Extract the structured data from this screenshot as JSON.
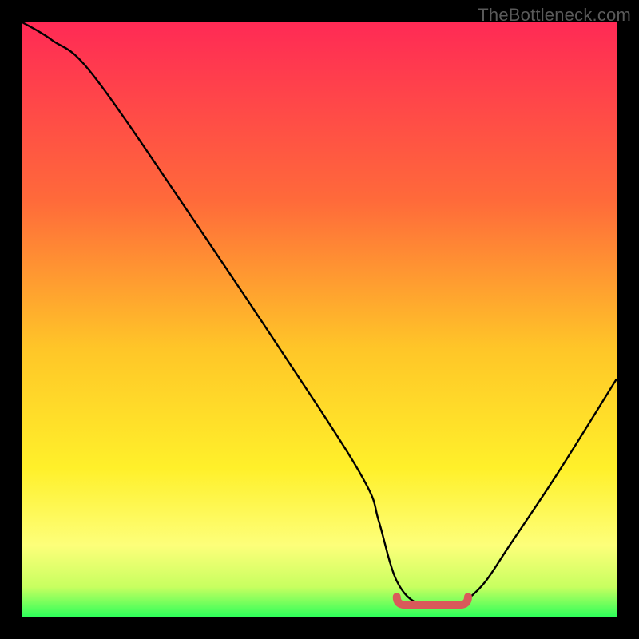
{
  "watermark": "TheBottleneck.com",
  "chart_data": {
    "type": "line",
    "title": "",
    "xlabel": "",
    "ylabel": "",
    "xlim": [
      0,
      100
    ],
    "ylim": [
      0,
      100
    ],
    "series": [
      {
        "name": "bottleneck-curve",
        "color": "#000000",
        "x": [
          0,
          5,
          12,
          30,
          50,
          58,
          60,
          63,
          67,
          73,
          75,
          78,
          82,
          90,
          100
        ],
        "y": [
          100,
          97,
          91,
          65,
          35,
          22,
          16,
          6,
          2,
          2,
          3,
          6,
          12,
          24,
          40
        ]
      },
      {
        "name": "optimal-range",
        "color": "#d95a5a",
        "x_start": 63,
        "x_end": 75,
        "y_level": 2
      }
    ],
    "gradient_stops": [
      {
        "offset": 0.0,
        "color": "#ff2a55"
      },
      {
        "offset": 0.3,
        "color": "#ff6a3a"
      },
      {
        "offset": 0.55,
        "color": "#ffc628"
      },
      {
        "offset": 0.75,
        "color": "#fff02a"
      },
      {
        "offset": 0.88,
        "color": "#fdff7a"
      },
      {
        "offset": 0.95,
        "color": "#c8ff60"
      },
      {
        "offset": 1.0,
        "color": "#2fff5a"
      }
    ]
  }
}
